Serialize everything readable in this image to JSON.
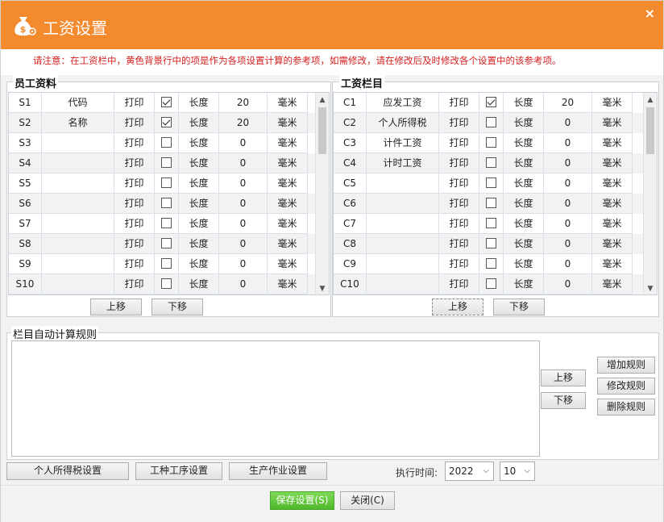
{
  "window": {
    "title": "工资设置",
    "close_glyph": "×",
    "notice": "请注意：在工资栏中，黄色背景行中的项是作为各项设置计算的参考项，如需修改，请在修改后及时修改各个设置中的该参考项。",
    "accent": "#f48a2e",
    "notice_color": "#d42020"
  },
  "employee_panel": {
    "title": "员工资料",
    "rows": [
      {
        "id": "S1",
        "name": "代码",
        "print": "打印",
        "checked": true,
        "len_label": "长度",
        "len": "20",
        "unit": "毫米"
      },
      {
        "id": "S2",
        "name": "名称",
        "print": "打印",
        "checked": true,
        "len_label": "长度",
        "len": "20",
        "unit": "毫米"
      },
      {
        "id": "S3",
        "name": "",
        "print": "打印",
        "checked": false,
        "len_label": "长度",
        "len": "0",
        "unit": "毫米"
      },
      {
        "id": "S4",
        "name": "",
        "print": "打印",
        "checked": false,
        "len_label": "长度",
        "len": "0",
        "unit": "毫米"
      },
      {
        "id": "S5",
        "name": "",
        "print": "打印",
        "checked": false,
        "len_label": "长度",
        "len": "0",
        "unit": "毫米"
      },
      {
        "id": "S6",
        "name": "",
        "print": "打印",
        "checked": false,
        "len_label": "长度",
        "len": "0",
        "unit": "毫米"
      },
      {
        "id": "S7",
        "name": "",
        "print": "打印",
        "checked": false,
        "len_label": "长度",
        "len": "0",
        "unit": "毫米"
      },
      {
        "id": "S8",
        "name": "",
        "print": "打印",
        "checked": false,
        "len_label": "长度",
        "len": "0",
        "unit": "毫米"
      },
      {
        "id": "S9",
        "name": "",
        "print": "打印",
        "checked": false,
        "len_label": "长度",
        "len": "0",
        "unit": "毫米"
      },
      {
        "id": "S10",
        "name": "",
        "print": "打印",
        "checked": false,
        "len_label": "长度",
        "len": "0",
        "unit": "毫米"
      }
    ],
    "up_label": "上移",
    "down_label": "下移"
  },
  "salary_panel": {
    "title": "工资栏目",
    "rows": [
      {
        "id": "C1",
        "name": "应发工资",
        "print": "打印",
        "checked": true,
        "len_label": "长度",
        "len": "20",
        "unit": "毫米"
      },
      {
        "id": "C2",
        "name": "个人所得税",
        "print": "打印",
        "checked": false,
        "len_label": "长度",
        "len": "0",
        "unit": "毫米"
      },
      {
        "id": "C3",
        "name": "计件工资",
        "print": "打印",
        "checked": false,
        "len_label": "长度",
        "len": "0",
        "unit": "毫米"
      },
      {
        "id": "C4",
        "name": "计时工资",
        "print": "打印",
        "checked": false,
        "len_label": "长度",
        "len": "0",
        "unit": "毫米"
      },
      {
        "id": "C5",
        "name": "",
        "print": "打印",
        "checked": false,
        "len_label": "长度",
        "len": "0",
        "unit": "毫米"
      },
      {
        "id": "C6",
        "name": "",
        "print": "打印",
        "checked": false,
        "len_label": "长度",
        "len": "0",
        "unit": "毫米"
      },
      {
        "id": "C7",
        "name": "",
        "print": "打印",
        "checked": false,
        "len_label": "长度",
        "len": "0",
        "unit": "毫米"
      },
      {
        "id": "C8",
        "name": "",
        "print": "打印",
        "checked": false,
        "len_label": "长度",
        "len": "0",
        "unit": "毫米"
      },
      {
        "id": "C9",
        "name": "",
        "print": "打印",
        "checked": false,
        "len_label": "长度",
        "len": "0",
        "unit": "毫米"
      },
      {
        "id": "C10",
        "name": "",
        "print": "打印",
        "checked": false,
        "len_label": "长度",
        "len": "0",
        "unit": "毫米"
      }
    ],
    "up_label": "上移",
    "down_label": "下移"
  },
  "rules_panel": {
    "title": "栏目自动计算规则",
    "up_label": "上移",
    "down_label": "下移",
    "add_label": "增加规则",
    "edit_label": "修改规则",
    "delete_label": "删除规则"
  },
  "footer": {
    "tax_settings_label": "个人所得税设置",
    "process_settings_label": "工种工序设置",
    "production_settings_label": "生产作业设置",
    "exec_time_label": "执行时间:",
    "year_value": "2022",
    "month_value": "10",
    "save_label": "保存设置(S)",
    "close_label": "关闭(C)"
  }
}
